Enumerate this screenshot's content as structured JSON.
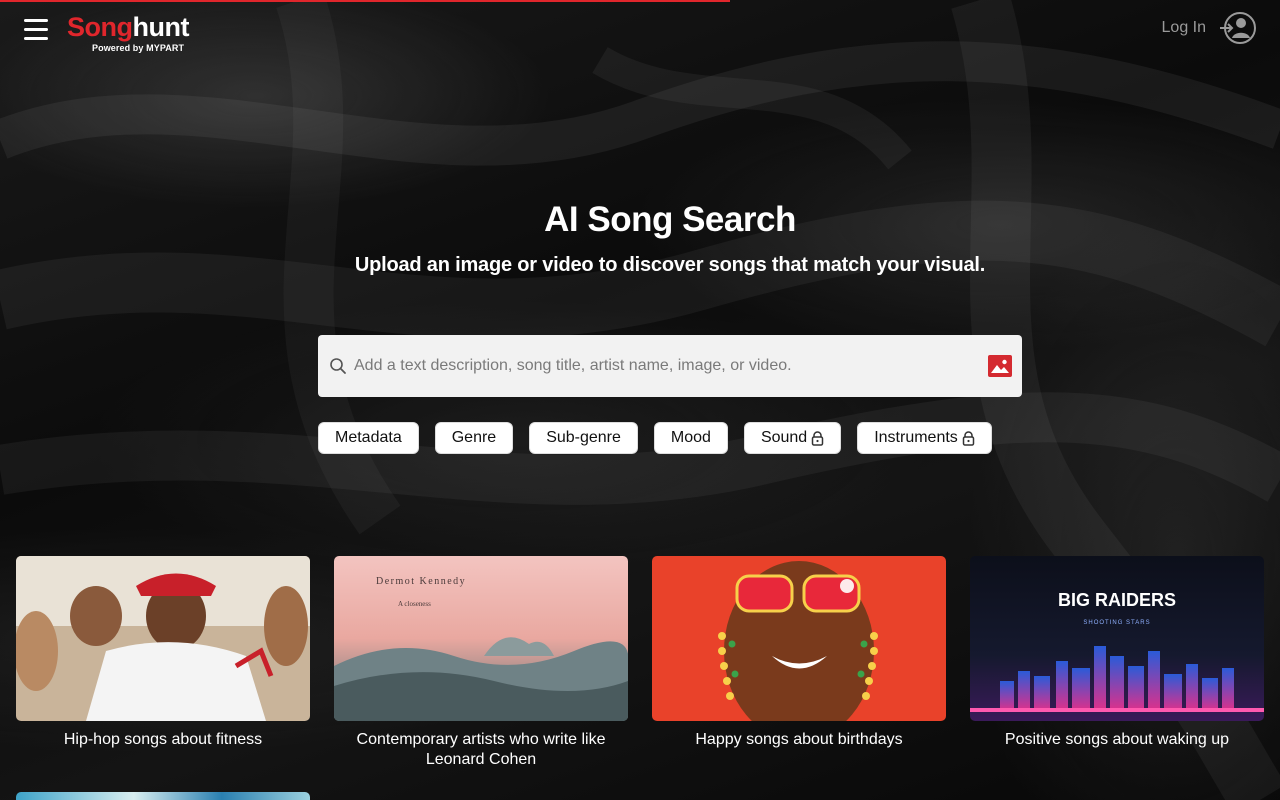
{
  "progress": 0.57,
  "header": {
    "logo_song": "Song",
    "logo_hunt": "hunt",
    "logo_powered": "Powered by MYPART",
    "login_label": "Log In"
  },
  "hero": {
    "title": "AI Song Search",
    "subtitle": "Upload an image or video to discover songs that match your visual."
  },
  "search": {
    "placeholder": "Add a text description, song title, artist name, image, or video."
  },
  "filters": [
    {
      "label": "Metadata",
      "locked": false
    },
    {
      "label": "Genre",
      "locked": false
    },
    {
      "label": "Sub-genre",
      "locked": false
    },
    {
      "label": "Mood",
      "locked": false
    },
    {
      "label": "Sound",
      "locked": true
    },
    {
      "label": "Instruments",
      "locked": true
    }
  ],
  "cards": [
    {
      "title": "Hip-hop songs about fitness"
    },
    {
      "title": "Contemporary artists who write like Leonard Cohen",
      "art_artist": "Dermot Kennedy",
      "art_subtitle": "A closeness"
    },
    {
      "title": "Happy songs about birthdays"
    },
    {
      "title": "Positive songs about waking up",
      "art_band": "BIG RAIDERS",
      "art_subtitle": "SHOOTING STARS"
    }
  ],
  "colors": {
    "accent": "#e0262c",
    "chip_bg": "#ffffff",
    "search_bg": "#f2f2f2"
  }
}
